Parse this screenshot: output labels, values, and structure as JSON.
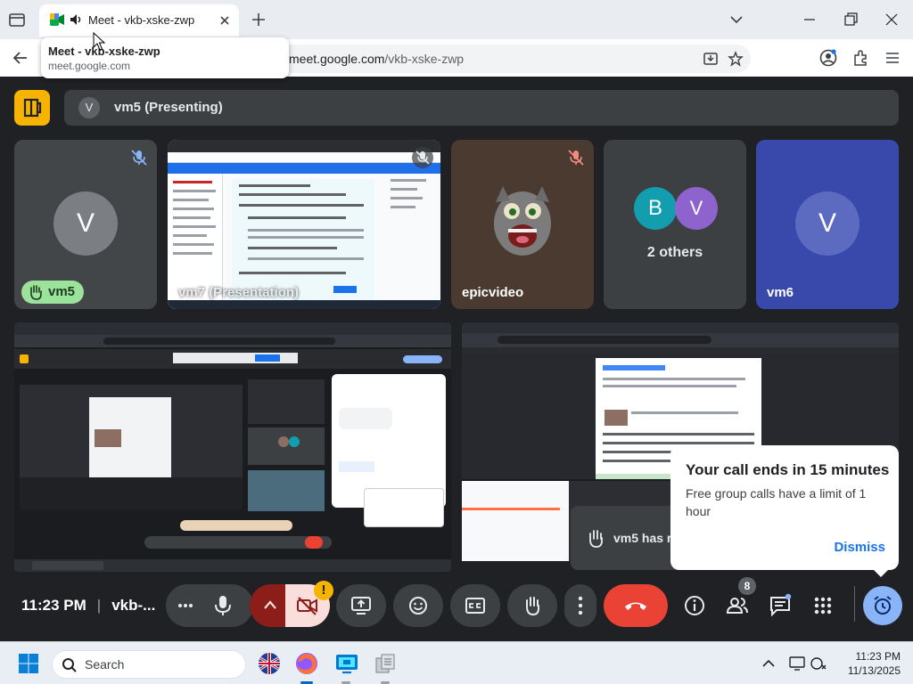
{
  "browser": {
    "tab": {
      "title": "Meet - vkb-xske-zwp",
      "favicon": "google-meet-icon",
      "audio_icon": "speaker-icon"
    },
    "hover_card": {
      "title": "Meet - vkb-xske-zwp",
      "host": "meet.google.com"
    },
    "url": {
      "host": "meet.google.com",
      "path": "/vkb-xske-zwp"
    }
  },
  "meet": {
    "presenting": {
      "avatar_letter": "V",
      "label": "vm5 (Presenting)"
    },
    "tiles": [
      {
        "id": "vm5",
        "avatar_letter": "V",
        "name": "vm5",
        "hand_raised": true,
        "mic_muted": true
      },
      {
        "id": "vm7",
        "name": "vm7 (Presentation)",
        "type": "screen"
      },
      {
        "id": "epicvideo",
        "name": "epicvideo",
        "mic_muted": true
      },
      {
        "id": "others",
        "avatars": [
          "B",
          "V"
        ],
        "label": "2 others"
      },
      {
        "id": "vm6",
        "avatar_letter": "V",
        "name": "vm6"
      }
    ],
    "toast": {
      "heading": "Your call ends in 15 minutes",
      "body": "Free group calls have a limit of 1 hour",
      "dismiss": "Dismiss"
    },
    "hand_toast": {
      "text": "vm5 has r"
    },
    "controls": {
      "time": "11:23 PM",
      "meeting_code": "vkb-...",
      "people_count": "8"
    },
    "colors": {
      "end_call": "#ea4335",
      "accent_yellow": "#f6b400",
      "toast_link": "#1a73e8",
      "hand_badge": "#9be29b"
    }
  },
  "taskbar": {
    "search_label": "Search",
    "clock_time": "11:23 PM",
    "clock_date": "11/13/2025"
  }
}
